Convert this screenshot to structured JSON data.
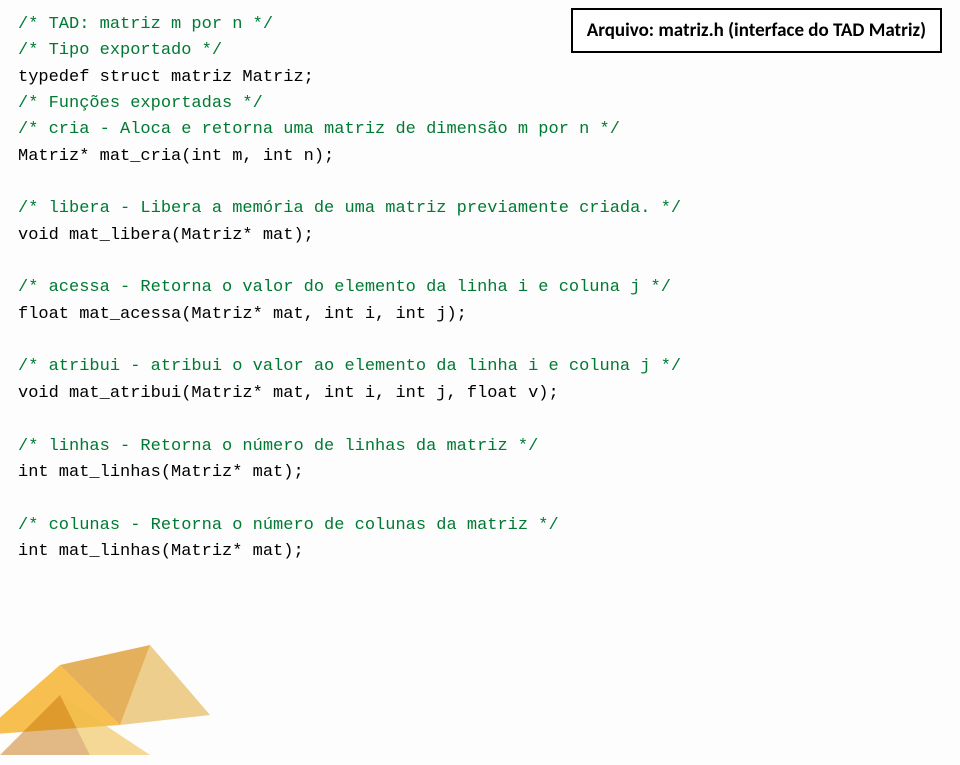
{
  "badge": {
    "label": "Arquivo: matriz.h (interface do TAD Matriz)"
  },
  "lines": {
    "l1": "/* TAD: matriz m por n */",
    "l2": "/* Tipo exportado */",
    "l3": "typedef struct matriz Matriz;",
    "l4": "/* Funções exportadas */",
    "l5": "/* cria - Aloca e retorna uma matriz de dimensão m por n */",
    "l6": "Matriz* mat_cria(int m, int n);",
    "l7": "/* libera - Libera a memória de uma matriz previamente criada. */",
    "l8": "void mat_libera(Matriz* mat);",
    "l9": "/* acessa - Retorna o valor do elemento da linha i e coluna j */",
    "l10": "float mat_acessa(Matriz* mat, int i, int j);",
    "l11": "/* atribui - atribui o valor ao elemento da linha i e coluna j */",
    "l12": "void mat_atribui(Matriz* mat, int i, int j, float v);",
    "l13": "/* linhas - Retorna o número de linhas da matriz */",
    "l14": "int mat_linhas(Matriz* mat);",
    "l15": "/* colunas - Retorna o número de colunas da matriz */",
    "l16": "int mat_linhas(Matriz* mat);"
  }
}
